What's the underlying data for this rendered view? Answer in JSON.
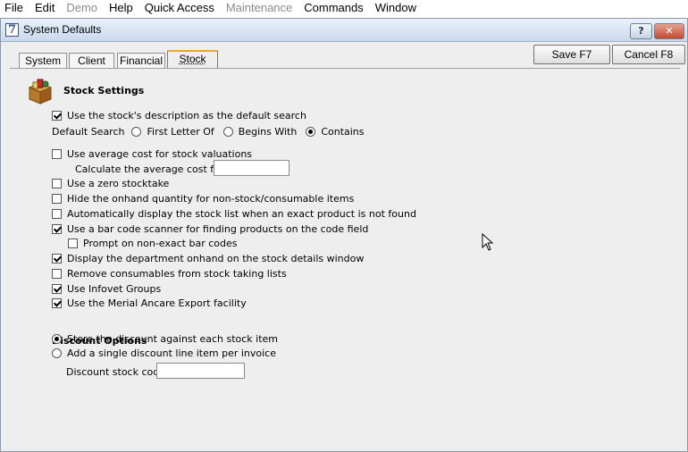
{
  "menubar": {
    "items": [
      {
        "label": "File",
        "enabled": true
      },
      {
        "label": "Edit",
        "enabled": true
      },
      {
        "label": "Demo",
        "enabled": false
      },
      {
        "label": "Help",
        "enabled": true
      },
      {
        "label": "Quick Access",
        "enabled": true
      },
      {
        "label": "Maintenance",
        "enabled": false
      },
      {
        "label": "Commands",
        "enabled": true
      },
      {
        "label": "Window",
        "enabled": true
      }
    ]
  },
  "window": {
    "icon_glyph": "7",
    "title": "System Defaults",
    "help_glyph": "?",
    "close_glyph": "✕"
  },
  "tabs": [
    {
      "label": "System",
      "active": false
    },
    {
      "label": "Client",
      "active": false
    },
    {
      "label": "Financial",
      "active": false
    },
    {
      "label": "Stock",
      "active": true
    }
  ],
  "buttons": {
    "save": "Save F7",
    "cancel": "Cancel F8"
  },
  "stock_settings": {
    "title": "Stock Settings",
    "use_description_search": {
      "label": "Use the stock's description as the default search",
      "checked": true
    },
    "default_search": {
      "label": "Default Search",
      "options": [
        "First Letter Of",
        "Begins With",
        "Contains"
      ],
      "selected": "Contains"
    },
    "average_cost": {
      "label": "Use average cost for stock valuations",
      "checked": false
    },
    "average_cost_from": {
      "label": "Calculate the average cost from",
      "value": ""
    },
    "zero_stocktake": {
      "label": "Use a zero stocktake",
      "checked": false
    },
    "hide_onhand": {
      "label": "Hide the onhand quantity for non-stock/consumable items",
      "checked": false
    },
    "auto_display_list": {
      "label": "Automatically display the stock list when an exact product is not found",
      "checked": false
    },
    "bar_code_scanner": {
      "label": "Use a bar code scanner for finding products on the code field",
      "checked": true
    },
    "prompt_non_exact": {
      "label": "Prompt on non-exact bar codes",
      "checked": false
    },
    "display_department": {
      "label": "Display the department onhand on the stock details window",
      "checked": true
    },
    "remove_consumables": {
      "label": "Remove consumables from stock taking lists",
      "checked": false
    },
    "infovet_groups": {
      "label": "Use Infovet Groups",
      "checked": true
    },
    "merial_ancare": {
      "label": "Use the Merial Ancare Export facility",
      "checked": true
    }
  },
  "discount_options": {
    "title": "Discount Options",
    "options": [
      "Store the discount against each stock item",
      "Add a single discount line item per invoice"
    ],
    "selected": "Store the discount against each stock item",
    "stock_code": {
      "label": "Discount stock code",
      "value": ""
    }
  }
}
